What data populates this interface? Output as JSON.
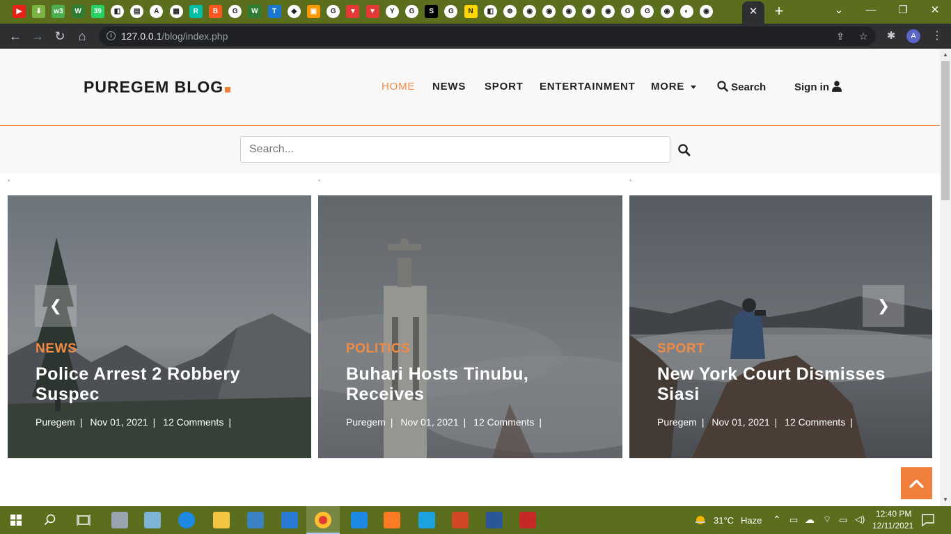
{
  "browser": {
    "tab_icons": [
      {
        "icon": "youtube-icon",
        "color": "#e62117",
        "glyph": "▶"
      },
      {
        "icon": "download-icon",
        "color": "#7cb342",
        "glyph": "⬇"
      },
      {
        "icon": "w3-icon",
        "color": "#4caf50",
        "glyph": "w3"
      },
      {
        "icon": "w-icon",
        "color": "#2e7d32",
        "glyph": "W"
      },
      {
        "icon": "whatsapp-icon",
        "color": "#25d366",
        "glyph": "39"
      },
      {
        "icon": "site-icon",
        "color": "#ffffff",
        "glyph": "◧"
      },
      {
        "icon": "doc-icon",
        "color": "#ffffff",
        "glyph": "▤"
      },
      {
        "icon": "a-icon",
        "color": "#ffffff",
        "glyph": "A"
      },
      {
        "icon": "news-icon",
        "color": "#ffffff",
        "glyph": "▦"
      },
      {
        "icon": "r-icon",
        "color": "#00bfa5",
        "glyph": "R"
      },
      {
        "icon": "blogger-icon",
        "color": "#ff5722",
        "glyph": "B"
      },
      {
        "icon": "google-icon",
        "color": "#ffffff",
        "glyph": "G"
      },
      {
        "icon": "w-icon-2",
        "color": "#2e7d32",
        "glyph": "W"
      },
      {
        "icon": "t-icon",
        "color": "#1976d2",
        "glyph": "T"
      },
      {
        "icon": "fb-icon",
        "color": "#ffffff",
        "glyph": "◆"
      },
      {
        "icon": "orange-icon",
        "color": "#ff9800",
        "glyph": "▣"
      },
      {
        "icon": "google-icon-2",
        "color": "#ffffff",
        "glyph": "G"
      },
      {
        "icon": "v-icon",
        "color": "#e53935",
        "glyph": "▼"
      },
      {
        "icon": "v-icon-2",
        "color": "#e53935",
        "glyph": "▼"
      },
      {
        "icon": "y-icon",
        "color": "#ffffff",
        "glyph": "Y"
      },
      {
        "icon": "google-icon-3",
        "color": "#ffffff",
        "glyph": "G"
      },
      {
        "icon": "s-icon",
        "color": "#000000",
        "glyph": "S"
      },
      {
        "icon": "google-icon-4",
        "color": "#ffffff",
        "glyph": "G"
      },
      {
        "icon": "new-icon",
        "color": "#ffd600",
        "glyph": "N"
      },
      {
        "icon": "site-icon-2",
        "color": "#ffffff",
        "glyph": "◧"
      },
      {
        "icon": "globe-icon",
        "color": "#ffffff",
        "glyph": "⊕"
      },
      {
        "icon": "web-icon",
        "color": "#ffffff",
        "glyph": "◉"
      },
      {
        "icon": "web-icon-2",
        "color": "#ffffff",
        "glyph": "◉"
      },
      {
        "icon": "web-icon-3",
        "color": "#ffffff",
        "glyph": "◉"
      },
      {
        "icon": "web-icon-4",
        "color": "#ffffff",
        "glyph": "◉"
      },
      {
        "icon": "web-icon-5",
        "color": "#ffffff",
        "glyph": "◉"
      },
      {
        "icon": "google-icon-5",
        "color": "#ffffff",
        "glyph": "G"
      },
      {
        "icon": "google-icon-6",
        "color": "#ffffff",
        "glyph": "G"
      },
      {
        "icon": "web-icon-6",
        "color": "#ffffff",
        "glyph": "◉"
      },
      {
        "icon": "github-icon",
        "color": "#ffffff",
        "glyph": "◐"
      },
      {
        "icon": "web-icon-7",
        "color": "#ffffff",
        "glyph": "◉"
      }
    ],
    "address_host": "127.0.0.1",
    "address_path": "/blog/index.php",
    "profile_initial": "A"
  },
  "site": {
    "logo": "PUREGEM BLOG",
    "accent_color": "#f08a45",
    "nav": {
      "home": "HOME",
      "news": "NEWS",
      "sport": "SPORT",
      "entertainment": "ENTERTAINMENT",
      "more": "MORE",
      "search": "Search",
      "signin": "Sign in"
    },
    "search_placeholder": "Search...",
    "tick_mark": "`"
  },
  "cards": [
    {
      "category": "NEWS",
      "title": "Police Arrest 2 Robbery Suspec",
      "author": "Puregem",
      "date": "Nov 01, 2021",
      "comments": "12 Comments"
    },
    {
      "category": "POLITICS",
      "title": "Buhari Hosts Tinubu, Receives",
      "author": "Puregem",
      "date": "Nov 01, 2021",
      "comments": "12 Comments"
    },
    {
      "category": "SPORT",
      "title": "New York Court Dismisses Siasi",
      "author": "Puregem",
      "date": "Nov 01, 2021",
      "comments": "12 Comments"
    }
  ],
  "carousel": {
    "prev": "❮",
    "next": "❯"
  },
  "taskbar": {
    "weather_temp": "31°C",
    "weather_desc": "Haze",
    "time": "12:40 PM",
    "date": "12/11/2021"
  }
}
